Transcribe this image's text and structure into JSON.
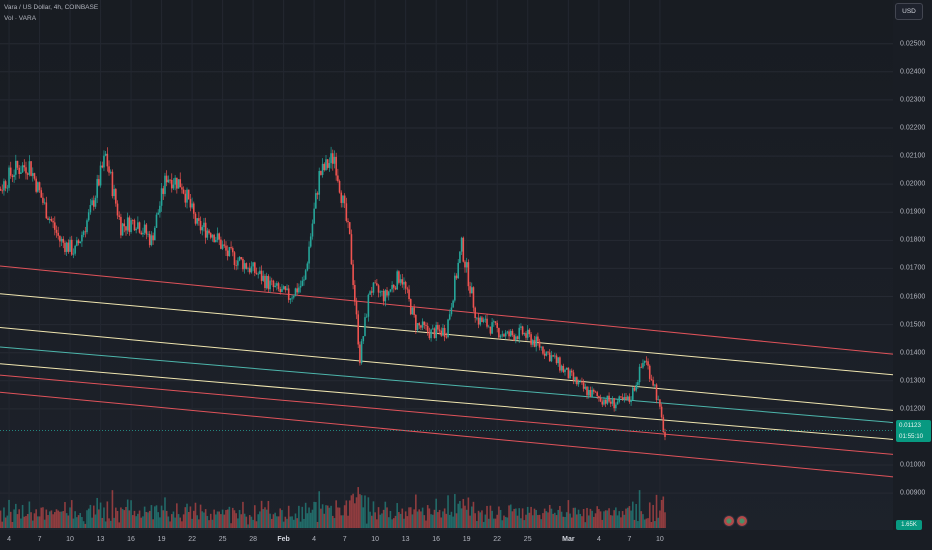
{
  "header": {
    "symbol_line": "Vara / US Dollar, 4h, COINBASE",
    "volume_line": "Vol · VARA"
  },
  "price_axis": {
    "currency_button": "USD",
    "labels": [
      "0.02500",
      "0.02400",
      "0.02300",
      "0.02200",
      "0.02100",
      "0.02000",
      "0.01900",
      "0.01800",
      "0.01700",
      "0.01600",
      "0.01500",
      "0.01400",
      "0.01300",
      "0.01200",
      "0.01000",
      "0.00900"
    ],
    "current_price": "0.01123",
    "countdown": "01:55:10",
    "volume_value": "1.65K"
  },
  "time_axis": {
    "labels": [
      "4",
      "7",
      "10",
      "13",
      "16",
      "19",
      "22",
      "25",
      "28",
      "Feb",
      "4",
      "7",
      "10",
      "13",
      "16",
      "19",
      "22",
      "25",
      "Mar",
      "4",
      "7",
      "10"
    ]
  },
  "colors": {
    "up": "#26a69a",
    "down": "#ef5350",
    "channel_red": "#e0535a",
    "channel_yellow": "#f0e6b0",
    "channel_teal": "#4db6ac"
  },
  "chart_data": {
    "type": "candlestick",
    "ylim": [
      0.0084,
      0.0262
    ],
    "x_range_days": [
      0,
      44
    ],
    "x_ticks": [
      {
        "label": "4",
        "day": 4
      },
      {
        "label": "7",
        "day": 7
      },
      {
        "label": "10",
        "day": 10
      },
      {
        "label": "13",
        "day": 13
      },
      {
        "label": "16",
        "day": 16
      },
      {
        "label": "19",
        "day": 19
      },
      {
        "label": "22",
        "day": 22
      },
      {
        "label": "25",
        "day": 25
      },
      {
        "label": "28",
        "day": 28
      },
      {
        "label": "Feb",
        "day": 31
      },
      {
        "label": "4",
        "day": 34
      },
      {
        "label": "7",
        "day": 37
      },
      {
        "label": "10",
        "day": 40
      },
      {
        "label": "13",
        "day": 43
      },
      {
        "label": "16",
        "day": 46
      },
      {
        "label": "19",
        "day": 49
      },
      {
        "label": "22",
        "day": 52
      },
      {
        "label": "25",
        "day": 55
      },
      {
        "label": "Mar",
        "day": 59
      },
      {
        "label": "4",
        "day": 62
      },
      {
        "label": "7",
        "day": 65
      },
      {
        "label": "10",
        "day": 68
      }
    ],
    "close_path": [
      [
        1.5,
        0.0188
      ],
      [
        3,
        0.0198
      ],
      [
        4.5,
        0.0205
      ],
      [
        6,
        0.0207
      ],
      [
        7.5,
        0.0192
      ],
      [
        9,
        0.018
      ],
      [
        10.5,
        0.0176
      ],
      [
        12,
        0.019
      ],
      [
        13.5,
        0.021
      ],
      [
        15,
        0.0185
      ],
      [
        16.5,
        0.0187
      ],
      [
        18,
        0.018
      ],
      [
        19.5,
        0.0203
      ],
      [
        21,
        0.02
      ],
      [
        22.5,
        0.0185
      ],
      [
        24,
        0.0183
      ],
      [
        25.5,
        0.0175
      ],
      [
        27,
        0.0172
      ],
      [
        28.5,
        0.0168
      ],
      [
        30,
        0.0163
      ],
      [
        31.5,
        0.016
      ],
      [
        33,
        0.0165
      ],
      [
        34.5,
        0.0203
      ],
      [
        36,
        0.021
      ],
      [
        37.5,
        0.018
      ],
      [
        38.5,
        0.0138
      ],
      [
        39.5,
        0.0163
      ],
      [
        41,
        0.016
      ],
      [
        42.5,
        0.0168
      ],
      [
        44,
        0.015
      ],
      [
        45.5,
        0.0147
      ],
      [
        47,
        0.0148
      ],
      [
        48.5,
        0.0178
      ],
      [
        50,
        0.0152
      ],
      [
        51.5,
        0.0149
      ],
      [
        53,
        0.0146
      ],
      [
        54.5,
        0.0147
      ],
      [
        56,
        0.0143
      ],
      [
        57.5,
        0.0138
      ],
      [
        59,
        0.0132
      ],
      [
        60.5,
        0.0127
      ],
      [
        62,
        0.0124
      ],
      [
        63.5,
        0.0122
      ],
      [
        65,
        0.0123
      ],
      [
        66.5,
        0.0138
      ],
      [
        67.5,
        0.0128
      ],
      [
        68.5,
        0.011
      ]
    ],
    "channel_lines": [
      {
        "color": "red",
        "from": [
          0,
          0.0172
        ],
        "to": [
          68.5,
          0.01475
        ]
      },
      {
        "color": "yellow",
        "from": [
          0,
          0.0162
        ],
        "to": [
          68.5,
          0.01395
        ]
      },
      {
        "color": "yellow",
        "from": [
          0,
          0.015
        ],
        "to": [
          68.5,
          0.0127
        ]
      },
      {
        "color": "teal",
        "from": [
          0,
          0.0143
        ],
        "to": [
          68.5,
          0.0122
        ]
      },
      {
        "color": "yellow",
        "from": [
          0,
          0.0137
        ],
        "to": [
          68.5,
          0.0116
        ]
      },
      {
        "color": "red",
        "from": [
          0,
          0.0133
        ],
        "to": [
          68.5,
          0.0111
        ]
      },
      {
        "color": "red",
        "from": [
          0,
          0.0127
        ],
        "to": [
          68.5,
          0.01035
        ]
      }
    ],
    "current_price": 0.01123,
    "grid": true
  }
}
